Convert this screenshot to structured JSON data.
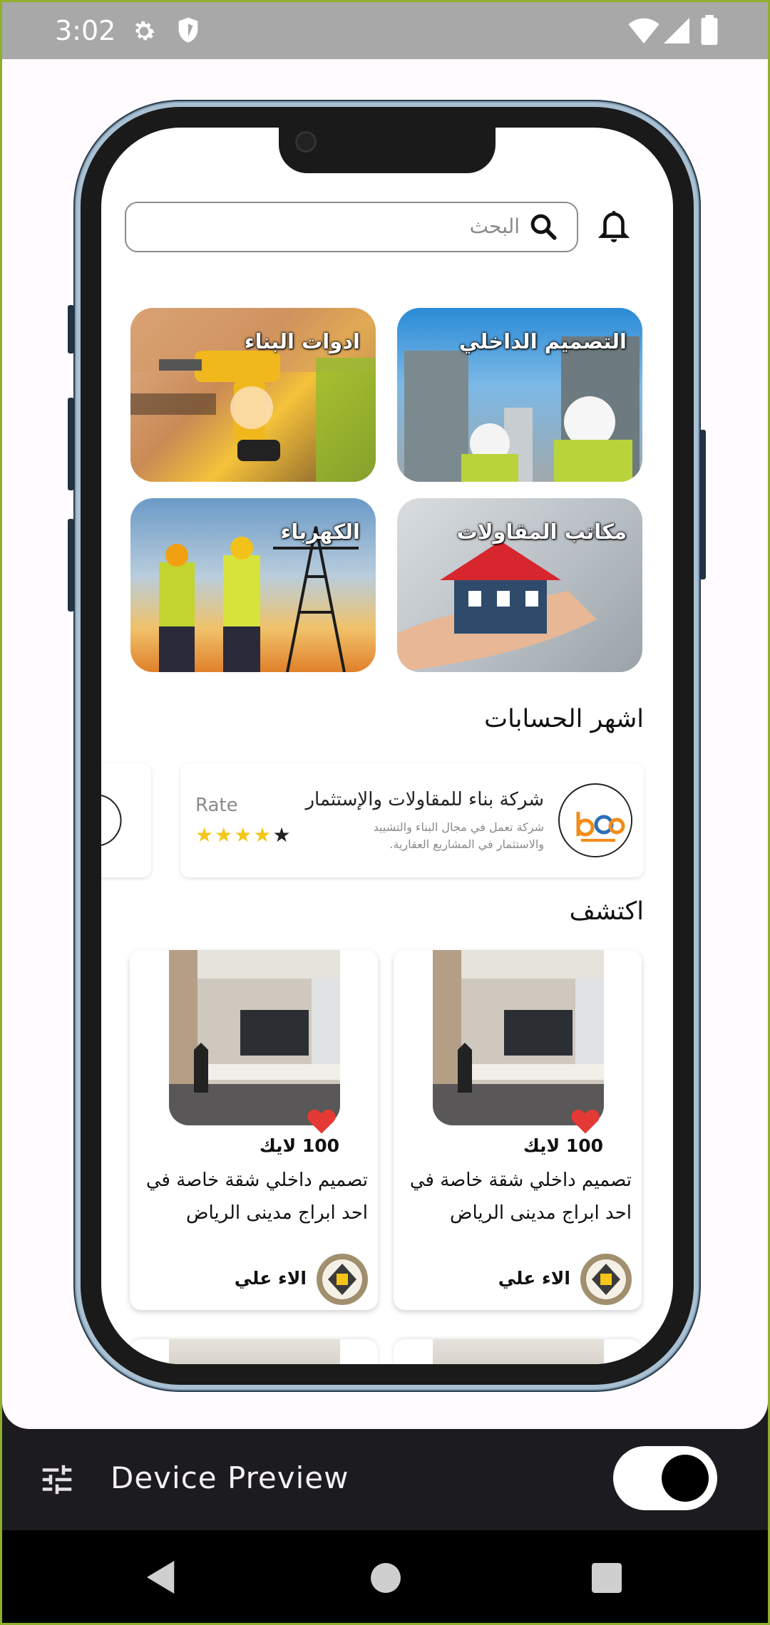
{
  "status_bar": {
    "time": "3:02"
  },
  "search": {
    "placeholder": "البحث"
  },
  "categories": [
    {
      "label": "ادوات البناء"
    },
    {
      "label": "التصميم الداخلي"
    },
    {
      "label": "الكهرباء"
    },
    {
      "label": "مكاتب المقاولات"
    }
  ],
  "popular": {
    "title": "اشهر الحسابات",
    "account": {
      "name": "شركة بناء للمقاولات والإستثمار",
      "description": "شركة تعمل في مجال البناء والتشييد والاستثمار في المشاريع العقارية.",
      "rate_label": "Rate",
      "stars": 4,
      "max_stars": 5
    }
  },
  "discover": {
    "title": "اكتشف",
    "posts": [
      {
        "likes": "100 لايك",
        "title": "تصميم داخلي شقة خاصة في احد ابراج مدينى الرياض",
        "author": "الاء علي"
      },
      {
        "likes": "100 لايك",
        "title": "تصميم داخلي شقة خاصة في احد ابراج مدينى الرياض",
        "author": "الاء علي"
      }
    ]
  },
  "device_preview": {
    "label": "Device Preview",
    "toggle_on": true
  },
  "colors": {
    "accent_heart": "#e53935",
    "star_filled": "#f5c518",
    "star_empty": "#222222"
  }
}
